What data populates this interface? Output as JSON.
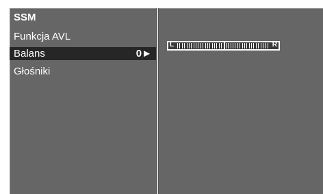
{
  "menu": {
    "items": [
      {
        "label": "SSM",
        "selected": false
      },
      {
        "label": "Funkcja AVL",
        "selected": false
      },
      {
        "label": "Balans",
        "selected": true,
        "value": "0►"
      },
      {
        "label": "Głośniki",
        "selected": false
      }
    ]
  },
  "balance": {
    "left_label": "L",
    "right_label": "R",
    "value": 0
  }
}
